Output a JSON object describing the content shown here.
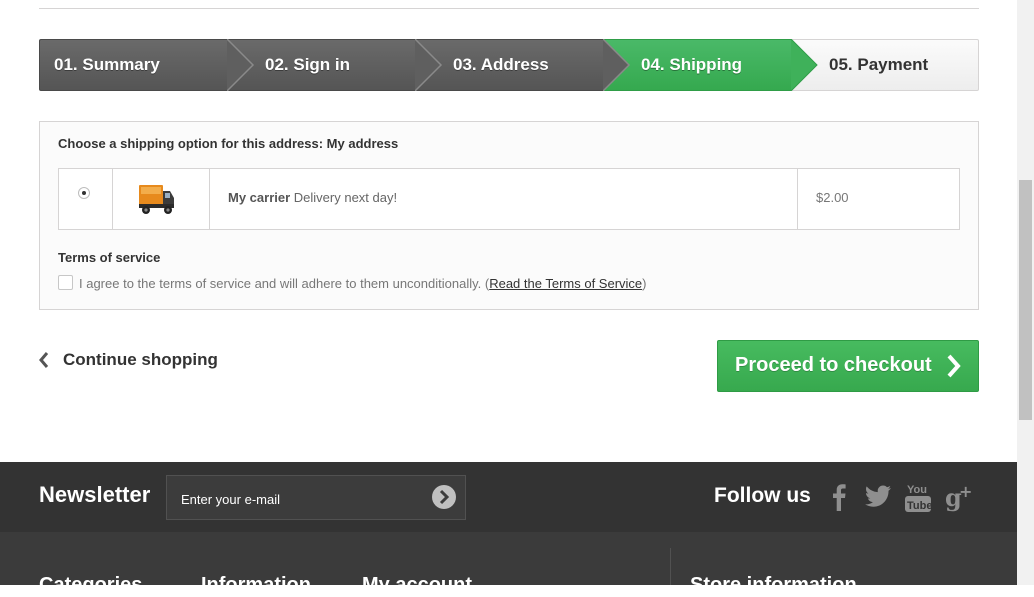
{
  "steps": [
    {
      "label": "01. Summary",
      "state": "done"
    },
    {
      "label": "02. Sign in",
      "state": "done"
    },
    {
      "label": "03. Address",
      "state": "done"
    },
    {
      "label": "04. Shipping",
      "state": "current"
    },
    {
      "label": "05. Payment",
      "state": "todo"
    }
  ],
  "shipping": {
    "title": "Choose a shipping option for this address: My address",
    "carrier": {
      "icon": "truck-icon",
      "name": "My carrier",
      "delay": " Delivery next day!",
      "price": "$2.00",
      "selected": true
    }
  },
  "terms": {
    "title": "Terms of service",
    "agree_text": "I agree to the terms of service and will adhere to them unconditionally. (",
    "link_text": "Read the Terms of Service",
    "close_paren": ")",
    "checked": false
  },
  "actions": {
    "continue_label": "Continue shopping",
    "checkout_label": "Proceed to checkout"
  },
  "footer": {
    "newsletter_title": "Newsletter",
    "newsletter_placeholder": "Enter your e-mail",
    "follow_title": "Follow us",
    "social": [
      "facebook-icon",
      "twitter-icon",
      "youtube-icon",
      "google-plus-icon"
    ],
    "columns": [
      "Categories",
      "Information",
      "My account",
      "Store information"
    ]
  },
  "colors": {
    "accent_green": "#3aae55",
    "step_grey": "#5f5f5f",
    "footer_bg": "#333333"
  }
}
